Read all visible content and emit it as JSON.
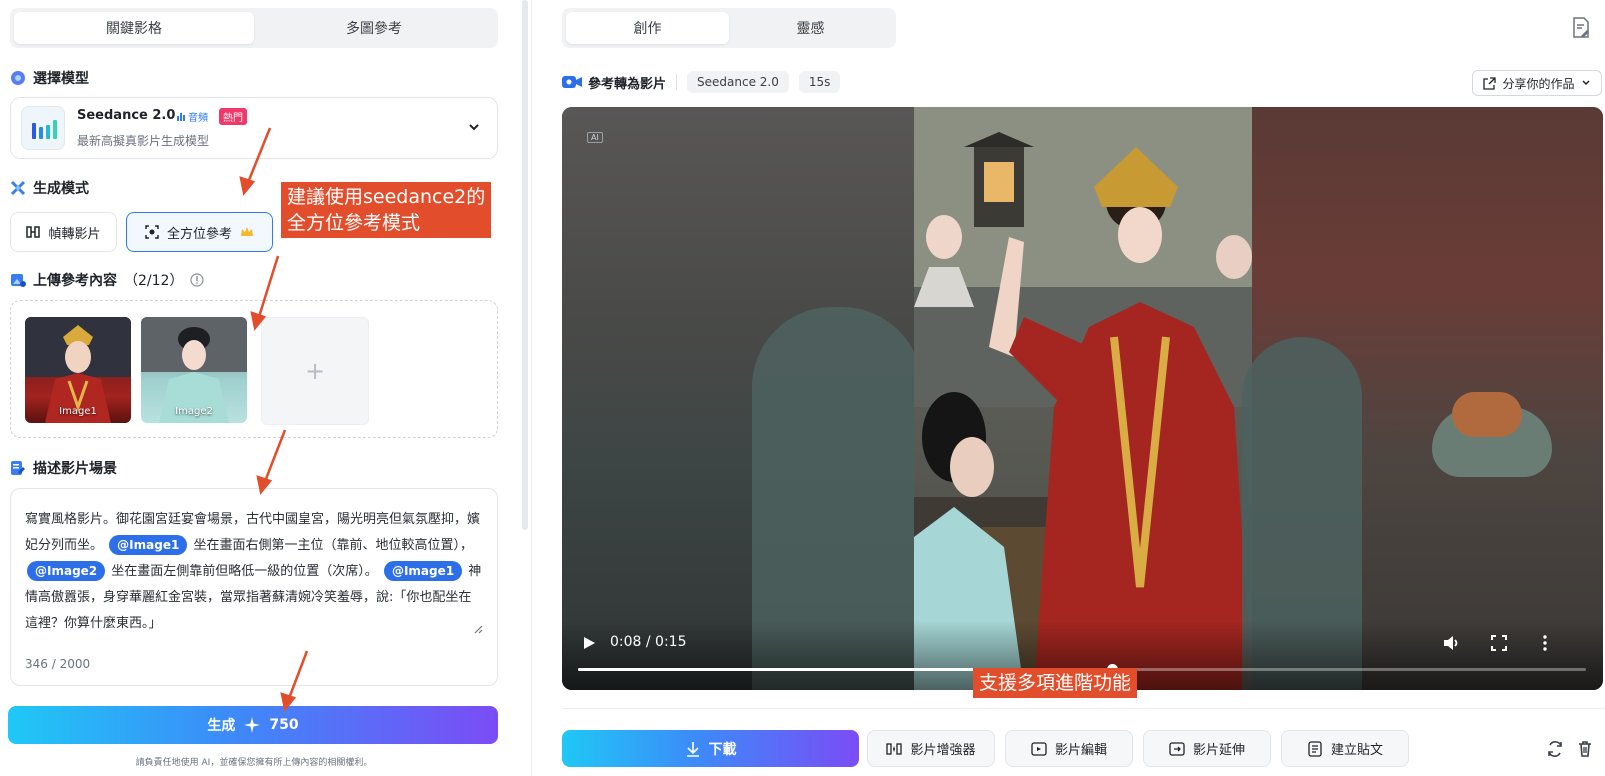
{
  "left": {
    "tabs": [
      "關鍵影格",
      "多圖參考"
    ],
    "model_section": {
      "title": "選擇模型"
    },
    "model": {
      "name": "Seedance 2.0",
      "audio_badge": "音頻",
      "hot_badge": "熱門",
      "desc": "最新高擬真影片生成模型"
    },
    "mode_section": {
      "title": "生成模式"
    },
    "modes": [
      "幀轉影片",
      "全方位參考"
    ],
    "upload_section": {
      "title": "上傳參考內容",
      "count": "（2/12）"
    },
    "thumbs": [
      "Image1",
      "Image2"
    ],
    "desc_section": {
      "title": "描述影片場景"
    },
    "desc": {
      "p1": "寫實風格影片。御花園宮廷宴會場景，古代中國皇宮，陽光明亮但氣氛壓抑，嬪妃分列而坐。",
      "tag1": "@Image1",
      "p2": "坐在畫面右側第一主位（靠前、地位較高位置），",
      "tag2": "@Image2",
      "p3": "坐在畫面左側靠前但略低一級的位置（次席）。",
      "tag3": "@Image1",
      "p4": "神情高傲囂張，身穿華麗紅金宮裝，當眾指著蘇清婉冷笑羞辱，說:「你也配坐在這裡？你算什麼東西。」"
    },
    "char_count": "346 / 2000",
    "generate": {
      "label": "生成",
      "credits": "750"
    },
    "disclaimer": "請負責任地使用 AI，並確保您擁有所上傳內容的相關權利。"
  },
  "annotations": {
    "box1_line1": "建議使用seedance2的",
    "box1_line2": "全方位參考模式",
    "box2": "支援多項進階功能"
  },
  "right": {
    "tabs": [
      "創作",
      "靈感"
    ],
    "meta": {
      "title": "參考轉為影片",
      "model": "Seedance 2.0",
      "duration": "15s"
    },
    "share": "分享你的作品",
    "video": {
      "ai_badge": "AI",
      "time": "0:08 / 0:15",
      "progress": 0.53
    },
    "download": "下載",
    "actions": [
      "影片增強器",
      "影片編輯",
      "影片延伸",
      "建立貼文"
    ]
  },
  "colors": {
    "accent": "#2d7bf4",
    "hot": "#f0386b",
    "annotation": "#e24d2b"
  }
}
